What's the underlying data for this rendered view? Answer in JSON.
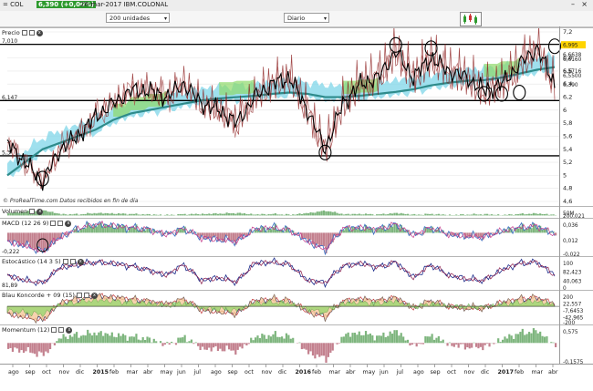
{
  "header": {
    "title_prefix": "= COL",
    "price_badge": "6,390 (+0,00%)",
    "date_name": "26-mar-2017 IBM.COLONAL"
  },
  "toolbar": {
    "units_select": "200 unidades",
    "period_select": "Diario"
  },
  "panels": {
    "price": {
      "title": "Precio",
      "credit": "© ProRealTime.com  Datos recibidos en fin de día"
    },
    "volume": {
      "title": "Volumen"
    },
    "macd": {
      "title": "MACD (12 26 9)"
    },
    "stochastic": {
      "title": "Estocástico (14 3 5)"
    },
    "blau": {
      "title": "Blau Koncorde + 09 (15)"
    },
    "momentum": {
      "title": "Momentum (12)"
    }
  },
  "colors": {
    "price_line": "#000000",
    "ma_fast": "#8b1a1a",
    "ma_slow": "#2e8b8b",
    "cloud": "#7fd6e8",
    "cloud_green": "#8fd86a",
    "current_badge": "#ffd400",
    "pos_hist": "#66a866",
    "neg_hist": "#b86a7a"
  },
  "chart_data": {
    "type": "line",
    "price": {
      "x": [
        "2014-08",
        "2014-09",
        "2014-10",
        "2014-11",
        "2014-12",
        "2015-01",
        "2015-02",
        "2015-03",
        "2015-04",
        "2015-05",
        "2015-06",
        "2015-07",
        "2015-08",
        "2015-09",
        "2015-10",
        "2015-11",
        "2015-12",
        "2016-01",
        "2016-02",
        "2016-03",
        "2016-04",
        "2016-05",
        "2016-06",
        "2016-07",
        "2016-08",
        "2016-09",
        "2016-10",
        "2016-11",
        "2016-12",
        "2017-01",
        "2017-02",
        "2017-03"
      ],
      "close": [
        5.5,
        5.2,
        4.9,
        5.4,
        5.6,
        5.9,
        6.1,
        6.3,
        6.3,
        6.2,
        6.4,
        6.1,
        6.0,
        5.8,
        6.2,
        6.4,
        6.5,
        6.0,
        5.4,
        6.1,
        6.4,
        6.5,
        6.9,
        6.5,
        6.8,
        6.6,
        6.5,
        6.3,
        6.4,
        6.7,
        6.95,
        6.4
      ],
      "ma_slow": [
        5.0,
        5.2,
        5.4,
        5.5,
        5.6,
        5.7,
        5.85,
        5.95,
        6.0,
        6.05,
        6.1,
        6.15,
        6.18,
        6.2,
        6.22,
        6.25,
        6.27,
        6.25,
        6.2,
        6.2,
        6.22,
        6.25,
        6.28,
        6.32,
        6.38,
        6.42,
        6.45,
        6.46,
        6.5,
        6.56,
        6.62,
        6.66
      ],
      "ylim": [
        4.6,
        7.2
      ],
      "y_ticks": [
        "7,2",
        "7",
        "6,8",
        "6,6",
        "6,4",
        "6,2",
        "6",
        "5,8",
        "5,6",
        "5,4",
        "5,2",
        "5",
        "4,8",
        "4,6"
      ],
      "horizontal_levels": [
        {
          "label": "7,010",
          "value": 7.01
        },
        {
          "label": "6,147",
          "value": 6.147
        },
        {
          "label": "5,3",
          "value": 5.3
        }
      ],
      "right_labels": [
        {
          "label": "6,995",
          "value": 6.995
        },
        {
          "label": "6,6638",
          "value": 6.85
        },
        {
          "label": "6,6160",
          "value": 6.78
        },
        {
          "label": "6,5716",
          "value": 6.6
        },
        {
          "label": "6,5500",
          "value": 6.53
        },
        {
          "label": "6,390",
          "value": 6.39
        }
      ],
      "circled_points": [
        {
          "x": "2014-10",
          "value": 4.95
        },
        {
          "x": "2016-02",
          "value": 5.35
        },
        {
          "x": "2016-06",
          "value": 7.0
        },
        {
          "x": "2016-08",
          "value": 6.95
        },
        {
          "x": "2016-11",
          "value": 6.25
        },
        {
          "x": "2016-12",
          "value": 6.25
        },
        {
          "x": "2017-01",
          "value": 6.27
        },
        {
          "x": "2017-03",
          "value": 6.98
        }
      ]
    },
    "volume": {
      "labels": [
        "50M",
        "200,021"
      ]
    },
    "macd": {
      "left_label": "-0,222",
      "right_labels": [
        "0,036",
        "0,012",
        "-0,022"
      ],
      "values": [
        -0.1,
        -0.15,
        -0.22,
        -0.05,
        0.05,
        0.1,
        0.08,
        0.06,
        0.04,
        -0.02,
        0.05,
        -0.06,
        -0.08,
        -0.1,
        0.04,
        0.06,
        0.03,
        -0.1,
        -0.2,
        0.05,
        0.06,
        0.04,
        0.1,
        -0.03,
        0.06,
        -0.02,
        -0.04,
        -0.05,
        0.02,
        0.06,
        0.08,
        -0.02
      ]
    },
    "stochastic": {
      "left_label": "81,89",
      "right_labels": [
        "100",
        "82,423",
        "40,063",
        "0"
      ],
      "values": [
        40,
        20,
        10,
        70,
        80,
        90,
        85,
        75,
        60,
        40,
        80,
        20,
        30,
        15,
        85,
        90,
        80,
        20,
        10,
        75,
        85,
        70,
        90,
        30,
        80,
        40,
        25,
        20,
        60,
        85,
        90,
        40
      ]
    },
    "blau": {
      "right_labels": [
        "200",
        "22,557",
        "-7,6453",
        "-42,965",
        "-200"
      ],
      "values": [
        -40,
        -60,
        -80,
        20,
        40,
        60,
        50,
        40,
        30,
        10,
        40,
        -20,
        -30,
        -40,
        30,
        40,
        30,
        -30,
        -60,
        30,
        40,
        30,
        50,
        -10,
        30,
        0,
        -10,
        -10,
        20,
        40,
        50,
        10
      ]
    },
    "momentum": {
      "right_labels": [
        "0,575",
        "-0,1575"
      ],
      "values": [
        -0.3,
        -0.4,
        -0.6,
        0.3,
        0.4,
        0.5,
        0.4,
        0.3,
        0.2,
        -0.1,
        0.3,
        -0.3,
        -0.3,
        -0.4,
        0.3,
        0.4,
        0.3,
        -0.5,
        -0.8,
        0.4,
        0.5,
        0.3,
        0.6,
        -0.2,
        0.4,
        -0.1,
        -0.2,
        -0.2,
        0.2,
        0.5,
        0.6,
        -0.16
      ]
    },
    "x_axis_labels": [
      "ago",
      "sep",
      "oct",
      "nov",
      "dic",
      "2015",
      "feb",
      "mar",
      "abr",
      "may",
      "jun",
      "jul",
      "ago",
      "sep",
      "oct",
      "nov",
      "dic",
      "2016",
      "feb",
      "mar",
      "abr",
      "may",
      "jun",
      "jul",
      "ago",
      "sep",
      "oct",
      "nov",
      "dic",
      "2017",
      "feb",
      "mar",
      "abr"
    ]
  }
}
